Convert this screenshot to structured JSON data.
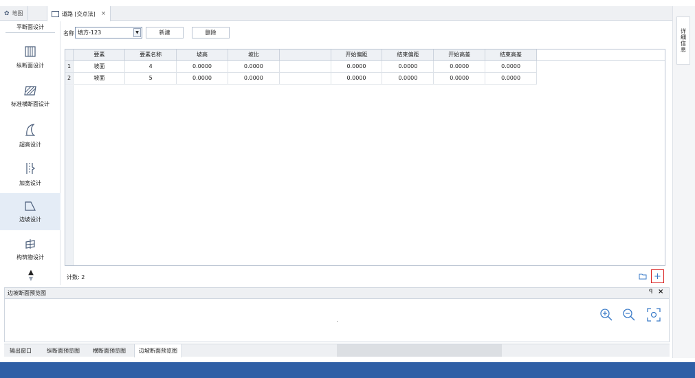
{
  "tabs": [
    {
      "label": "地图",
      "icon": "gear-icon"
    },
    {
      "label": "道路 [交点法]",
      "icon": "document-icon",
      "close": "×"
    }
  ],
  "right_panel": {
    "label": "详细信息"
  },
  "sidebar": {
    "title": "平断面设计",
    "items": [
      {
        "label": "纵断面设计",
        "icon": "profile-icon"
      },
      {
        "label": "标准横断面设计",
        "icon": "cross-section-icon"
      },
      {
        "label": "超高设计",
        "icon": "superelevation-icon"
      },
      {
        "label": "加宽设计",
        "icon": "widening-icon"
      },
      {
        "label": "边坡设计",
        "icon": "slope-icon"
      },
      {
        "label": "构筑物设计",
        "icon": "structure-icon"
      }
    ]
  },
  "toolbar": {
    "name_label": "名称",
    "select_value": "填方-123",
    "new_label": "新建",
    "delete_label": "删除"
  },
  "grid": {
    "columns": [
      "要素",
      "要素名称",
      "坡高",
      "坡比",
      "",
      "开始偏距",
      "结束偏距",
      "开始高差",
      "结束高差"
    ],
    "rows": [
      [
        "1",
        "坡面",
        "4",
        "0.0000",
        "0.0000",
        "",
        "0.0000",
        "0.0000",
        "0.0000",
        "0.0000"
      ],
      [
        "2",
        "坡面",
        "5",
        "0.0000",
        "0.0000",
        "",
        "0.0000",
        "0.0000",
        "0.0000",
        "0.0000"
      ]
    ]
  },
  "count_label": "计数: 2",
  "preview": {
    "title": "边坡断面预览图",
    "pin": "ꟼ"
  },
  "bottom_tabs": [
    "输出窗口",
    "纵断面预览图",
    "横断面预览图",
    "边坡断面预览图"
  ],
  "colors": {
    "accent": "#2e5fa6",
    "highlight": "#d92020",
    "icon_blue": "#3a7bc8"
  }
}
